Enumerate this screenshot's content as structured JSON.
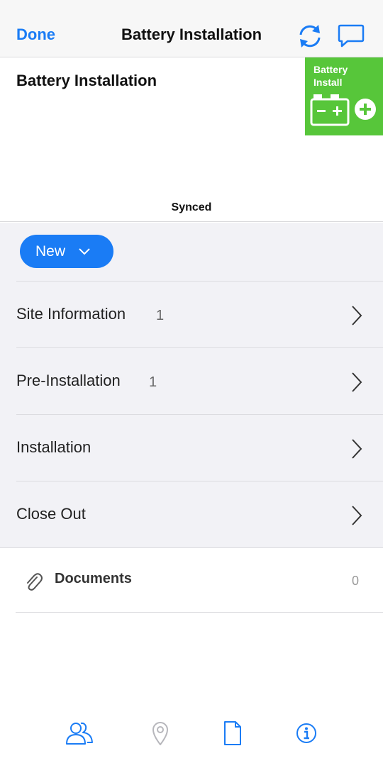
{
  "navbar": {
    "done_label": "Done",
    "title": "Battery Installation",
    "right_icons": [
      "sync-icon",
      "chat-bubble-icon"
    ]
  },
  "header": {
    "title": "Battery Installation",
    "badge_text": "Battery Install",
    "badge_color": "#57c63a",
    "status": "Synced"
  },
  "actions": {
    "new_label": "New",
    "accent": "#1a7cf5"
  },
  "sections": [
    {
      "label": "Site Information",
      "count": "1"
    },
    {
      "label": "Pre-Installation",
      "count": "1"
    },
    {
      "label": "Installation",
      "count": ""
    },
    {
      "label": "Close Out",
      "count": ""
    }
  ],
  "documents": {
    "label": "Documents",
    "count": "0",
    "icon": "paperclip-icon"
  },
  "tabbar": {
    "items": [
      "people-icon",
      "location-pin-icon",
      "document-icon",
      "info-icon"
    ],
    "active_color": "#1a7cf5",
    "inactive_color": "#b7b7bc"
  }
}
